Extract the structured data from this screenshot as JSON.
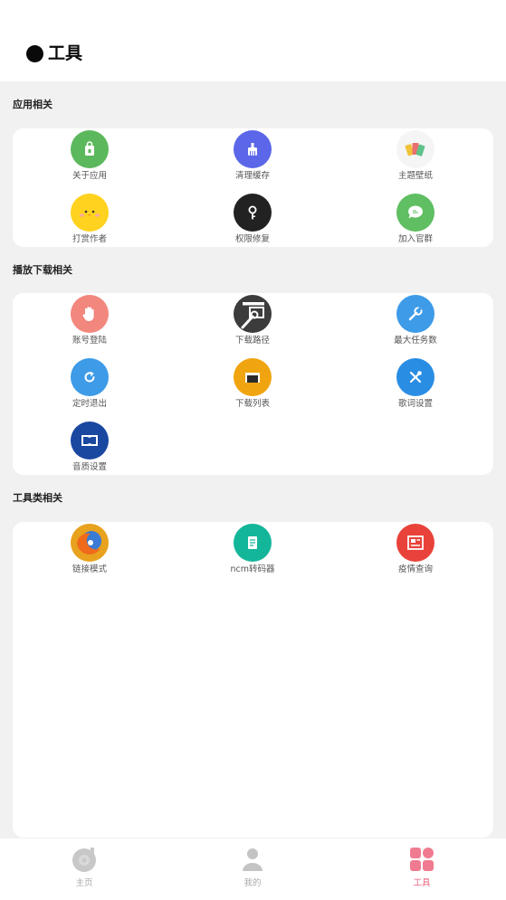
{
  "header": {
    "title": "工具"
  },
  "sections": [
    {
      "title": "应用相关",
      "items": [
        {
          "label": "关于应用",
          "icon": "shopping-bag-icon",
          "color": "#5cb85c"
        },
        {
          "label": "清理缓存",
          "icon": "broom-icon",
          "color": "#5b67e8"
        },
        {
          "label": "主题壁纸",
          "icon": "color-cards-icon",
          "color": "#f5f5f5"
        },
        {
          "label": "打赏作者",
          "icon": "chick-face-icon",
          "color": "#ffd21f"
        },
        {
          "label": "权限修复",
          "icon": "key-icon",
          "color": "#222222"
        },
        {
          "label": "加入官群",
          "icon": "chat-bubble-icon",
          "color": "#5fbf62"
        }
      ]
    },
    {
      "title": "播放下载相关",
      "items": [
        {
          "label": "账号登陆",
          "icon": "hand-icon",
          "color": "#f2877e"
        },
        {
          "label": "下载路径",
          "icon": "wrench-folder-icon",
          "color": "#3c3c3c"
        },
        {
          "label": "最大任务数",
          "icon": "wrench-icon",
          "color": "#3d9be8"
        },
        {
          "label": "定时退出",
          "icon": "refresh-icon",
          "color": "#3d9be8"
        },
        {
          "label": "下载列表",
          "icon": "folder-icon",
          "color": "#f0a40f"
        },
        {
          "label": "歌词设置",
          "icon": "tools-icon",
          "color": "#2a8de4"
        },
        {
          "label": "音质设置",
          "icon": "dolby-icon",
          "color": "#1a47a0"
        }
      ]
    },
    {
      "title": "工具类相关",
      "items": [
        {
          "label": "链接模式",
          "icon": "firefox-icon",
          "color": "#e8a21e"
        },
        {
          "label": "ncm转码器",
          "icon": "document-icon",
          "color": "#14b69a"
        },
        {
          "label": "疫情查询",
          "icon": "newspaper-icon",
          "color": "#e9423a"
        }
      ]
    }
  ],
  "tabbar": {
    "items": [
      {
        "label": "主页",
        "icon": "music-disc-icon",
        "active": false
      },
      {
        "label": "我的",
        "icon": "user-icon",
        "active": false
      },
      {
        "label": "工具",
        "icon": "grid-icon",
        "active": true
      }
    ],
    "active_color": "#e8607c"
  }
}
